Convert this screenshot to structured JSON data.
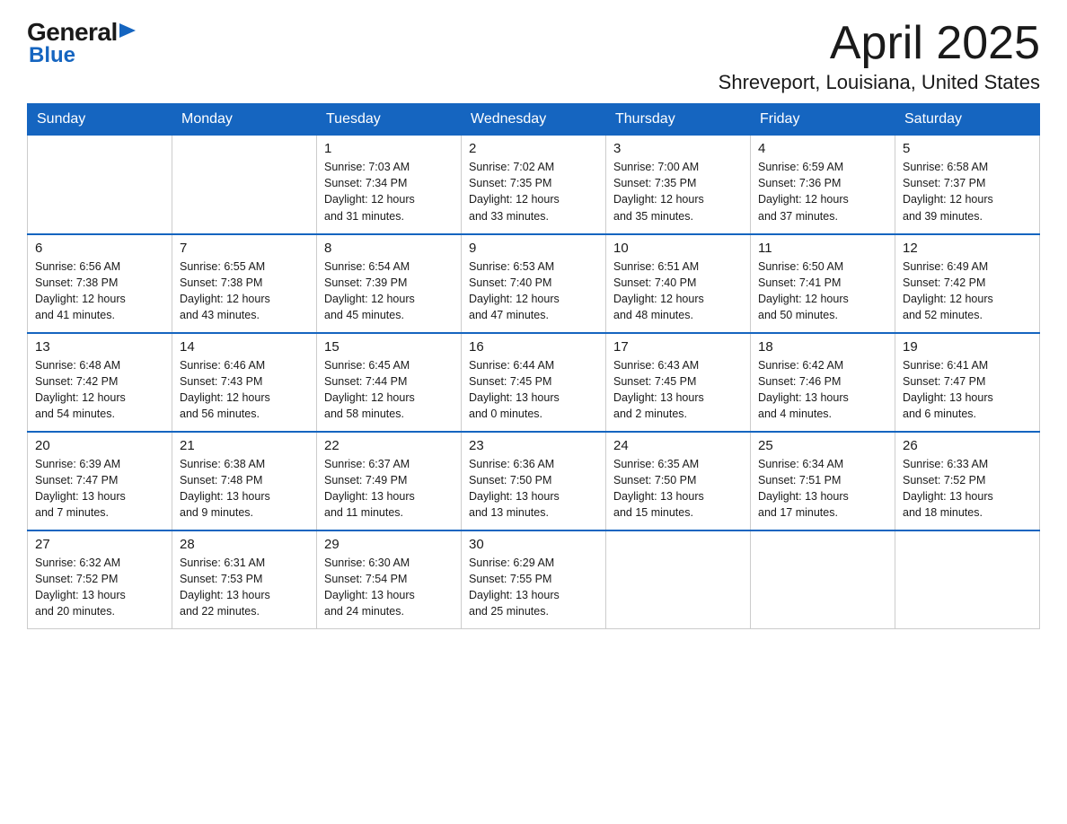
{
  "header": {
    "logo_general": "General",
    "logo_blue": "Blue",
    "month_year": "April 2025",
    "location": "Shreveport, Louisiana, United States"
  },
  "days_of_week": [
    "Sunday",
    "Monday",
    "Tuesday",
    "Wednesday",
    "Thursday",
    "Friday",
    "Saturday"
  ],
  "weeks": [
    [
      {
        "day": "",
        "info": ""
      },
      {
        "day": "",
        "info": ""
      },
      {
        "day": "1",
        "info": "Sunrise: 7:03 AM\nSunset: 7:34 PM\nDaylight: 12 hours\nand 31 minutes."
      },
      {
        "day": "2",
        "info": "Sunrise: 7:02 AM\nSunset: 7:35 PM\nDaylight: 12 hours\nand 33 minutes."
      },
      {
        "day": "3",
        "info": "Sunrise: 7:00 AM\nSunset: 7:35 PM\nDaylight: 12 hours\nand 35 minutes."
      },
      {
        "day": "4",
        "info": "Sunrise: 6:59 AM\nSunset: 7:36 PM\nDaylight: 12 hours\nand 37 minutes."
      },
      {
        "day": "5",
        "info": "Sunrise: 6:58 AM\nSunset: 7:37 PM\nDaylight: 12 hours\nand 39 minutes."
      }
    ],
    [
      {
        "day": "6",
        "info": "Sunrise: 6:56 AM\nSunset: 7:38 PM\nDaylight: 12 hours\nand 41 minutes."
      },
      {
        "day": "7",
        "info": "Sunrise: 6:55 AM\nSunset: 7:38 PM\nDaylight: 12 hours\nand 43 minutes."
      },
      {
        "day": "8",
        "info": "Sunrise: 6:54 AM\nSunset: 7:39 PM\nDaylight: 12 hours\nand 45 minutes."
      },
      {
        "day": "9",
        "info": "Sunrise: 6:53 AM\nSunset: 7:40 PM\nDaylight: 12 hours\nand 47 minutes."
      },
      {
        "day": "10",
        "info": "Sunrise: 6:51 AM\nSunset: 7:40 PM\nDaylight: 12 hours\nand 48 minutes."
      },
      {
        "day": "11",
        "info": "Sunrise: 6:50 AM\nSunset: 7:41 PM\nDaylight: 12 hours\nand 50 minutes."
      },
      {
        "day": "12",
        "info": "Sunrise: 6:49 AM\nSunset: 7:42 PM\nDaylight: 12 hours\nand 52 minutes."
      }
    ],
    [
      {
        "day": "13",
        "info": "Sunrise: 6:48 AM\nSunset: 7:42 PM\nDaylight: 12 hours\nand 54 minutes."
      },
      {
        "day": "14",
        "info": "Sunrise: 6:46 AM\nSunset: 7:43 PM\nDaylight: 12 hours\nand 56 minutes."
      },
      {
        "day": "15",
        "info": "Sunrise: 6:45 AM\nSunset: 7:44 PM\nDaylight: 12 hours\nand 58 minutes."
      },
      {
        "day": "16",
        "info": "Sunrise: 6:44 AM\nSunset: 7:45 PM\nDaylight: 13 hours\nand 0 minutes."
      },
      {
        "day": "17",
        "info": "Sunrise: 6:43 AM\nSunset: 7:45 PM\nDaylight: 13 hours\nand 2 minutes."
      },
      {
        "day": "18",
        "info": "Sunrise: 6:42 AM\nSunset: 7:46 PM\nDaylight: 13 hours\nand 4 minutes."
      },
      {
        "day": "19",
        "info": "Sunrise: 6:41 AM\nSunset: 7:47 PM\nDaylight: 13 hours\nand 6 minutes."
      }
    ],
    [
      {
        "day": "20",
        "info": "Sunrise: 6:39 AM\nSunset: 7:47 PM\nDaylight: 13 hours\nand 7 minutes."
      },
      {
        "day": "21",
        "info": "Sunrise: 6:38 AM\nSunset: 7:48 PM\nDaylight: 13 hours\nand 9 minutes."
      },
      {
        "day": "22",
        "info": "Sunrise: 6:37 AM\nSunset: 7:49 PM\nDaylight: 13 hours\nand 11 minutes."
      },
      {
        "day": "23",
        "info": "Sunrise: 6:36 AM\nSunset: 7:50 PM\nDaylight: 13 hours\nand 13 minutes."
      },
      {
        "day": "24",
        "info": "Sunrise: 6:35 AM\nSunset: 7:50 PM\nDaylight: 13 hours\nand 15 minutes."
      },
      {
        "day": "25",
        "info": "Sunrise: 6:34 AM\nSunset: 7:51 PM\nDaylight: 13 hours\nand 17 minutes."
      },
      {
        "day": "26",
        "info": "Sunrise: 6:33 AM\nSunset: 7:52 PM\nDaylight: 13 hours\nand 18 minutes."
      }
    ],
    [
      {
        "day": "27",
        "info": "Sunrise: 6:32 AM\nSunset: 7:52 PM\nDaylight: 13 hours\nand 20 minutes."
      },
      {
        "day": "28",
        "info": "Sunrise: 6:31 AM\nSunset: 7:53 PM\nDaylight: 13 hours\nand 22 minutes."
      },
      {
        "day": "29",
        "info": "Sunrise: 6:30 AM\nSunset: 7:54 PM\nDaylight: 13 hours\nand 24 minutes."
      },
      {
        "day": "30",
        "info": "Sunrise: 6:29 AM\nSunset: 7:55 PM\nDaylight: 13 hours\nand 25 minutes."
      },
      {
        "day": "",
        "info": ""
      },
      {
        "day": "",
        "info": ""
      },
      {
        "day": "",
        "info": ""
      }
    ]
  ]
}
